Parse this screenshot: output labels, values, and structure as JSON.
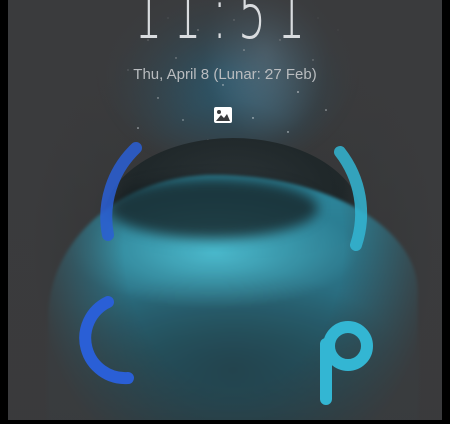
{
  "lockscreen": {
    "time": "11:51",
    "date": "Thu, April 8 (Lunar: 27 Feb)",
    "icons": {
      "wallpaper": "image-gallery-icon",
      "unlock_left": "c-arc-icon",
      "unlock_right": "p-letter-icon"
    },
    "colors": {
      "background": "#3a3b3d",
      "accent_blue": "#2a5fd6",
      "accent_cyan": "#33b6d3",
      "text": "#d9dcdf"
    }
  }
}
